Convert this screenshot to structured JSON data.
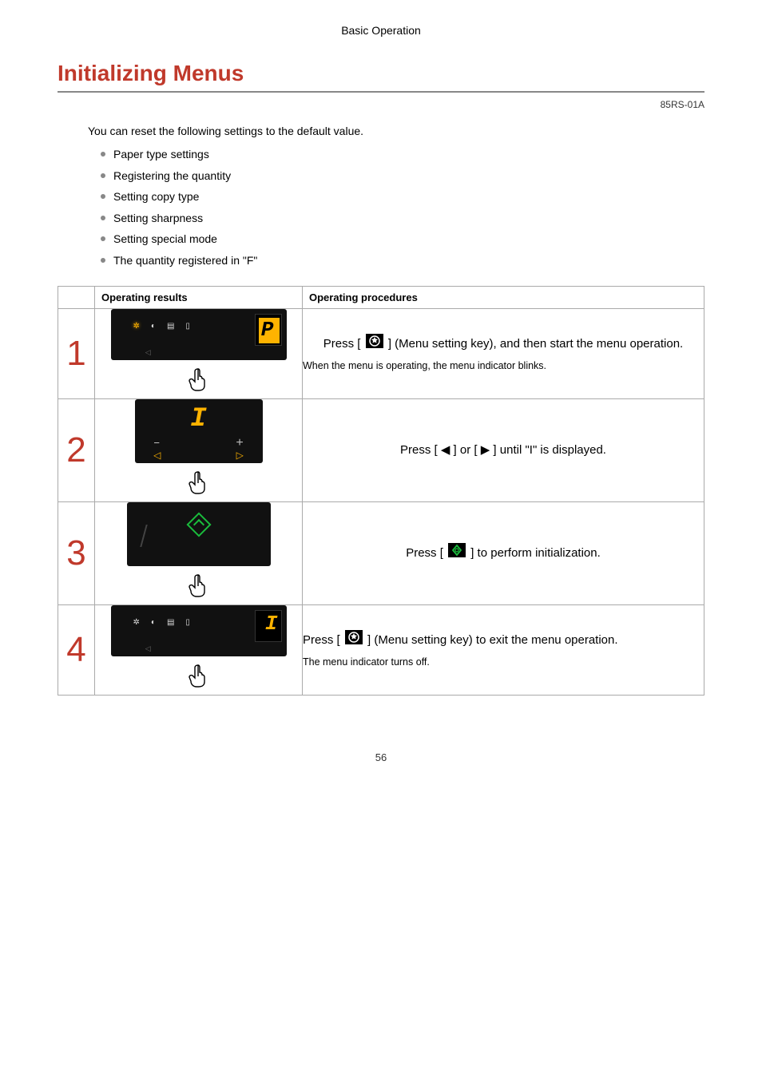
{
  "breadcrumb": "Basic Operation",
  "title": "Initializing Menus",
  "doc_code": "85RS-01A",
  "intro": "You can reset the following settings to the default value.",
  "bullets": [
    "Paper type settings",
    "Registering the quantity",
    "Setting copy type",
    "Setting sharpness",
    "Setting special mode",
    "The quantity registered in \"F\""
  ],
  "table": {
    "headers": {
      "num": "",
      "results": "Operating results",
      "procedures": "Operating procedures"
    },
    "rows": [
      {
        "num": "1",
        "display_char": "P",
        "display_highlight": true,
        "menu_indicator_lit": true,
        "proc_main_pre": "Press [ ",
        "proc_main_post": " ] (Menu setting key), and then start the menu operation.",
        "proc_sub": "When the menu is operating, the menu indicator blinks."
      },
      {
        "num": "2",
        "display_char": "I",
        "proc_main": "Press [ ◀ ] or [ ▶ ] until \"I\" is displayed."
      },
      {
        "num": "3",
        "proc_main_pre": "Press [ ",
        "proc_main_post": " ] to perform initialization."
      },
      {
        "num": "4",
        "display_char": "I",
        "display_highlight": false,
        "menu_indicator_lit": false,
        "proc_main_pre": "Press [ ",
        "proc_main_post": " ] (Menu setting key) to exit the menu operation.",
        "proc_sub": "The menu indicator turns off."
      }
    ]
  },
  "page_number": "56"
}
